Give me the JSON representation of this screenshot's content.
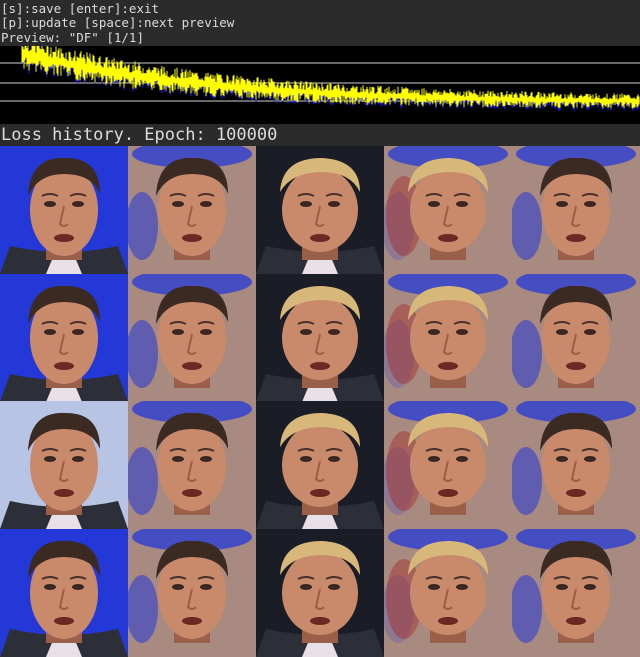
{
  "header": {
    "help_line_1": "[s]:save [enter]:exit",
    "help_line_2": "[p]:update [space]:next preview",
    "preview_line": "Preview: \"DF\" [1/1]"
  },
  "loss_graph": {
    "background": "#000000",
    "series_color": "#ffff00",
    "series_color_b": "#1a1aff",
    "gridline_color": "#d0d0d0"
  },
  "status": {
    "text": "Loss history. Epoch: 100000"
  },
  "preview_grid": {
    "columns": [
      "src-original",
      "src-reconstruction",
      "dst-original",
      "dst-reconstruction",
      "swapped"
    ],
    "rows": 4,
    "tiles": [
      [
        "cage-icon",
        "cage-icon",
        "trump-icon",
        "trump-icon",
        "cage-icon"
      ],
      [
        "cage-icon",
        "cage-icon",
        "trump-icon",
        "trump-icon",
        "cage-icon"
      ],
      [
        "cage-icon",
        "cage-icon",
        "trump-icon",
        "trump-icon",
        "cage-icon"
      ],
      [
        "cage-icon",
        "cage-icon",
        "trump-icon",
        "trump-icon",
        "cage-icon"
      ]
    ],
    "colors": {
      "skin": "#c98a6c",
      "skin_shadow": "#9a5f48",
      "cage_hair": "#3a2a22",
      "trump_hair": "#d8b87a",
      "blue_bg": "#2438d8",
      "suit": "#2d2f38",
      "shirt": "#e8e0e6"
    }
  }
}
